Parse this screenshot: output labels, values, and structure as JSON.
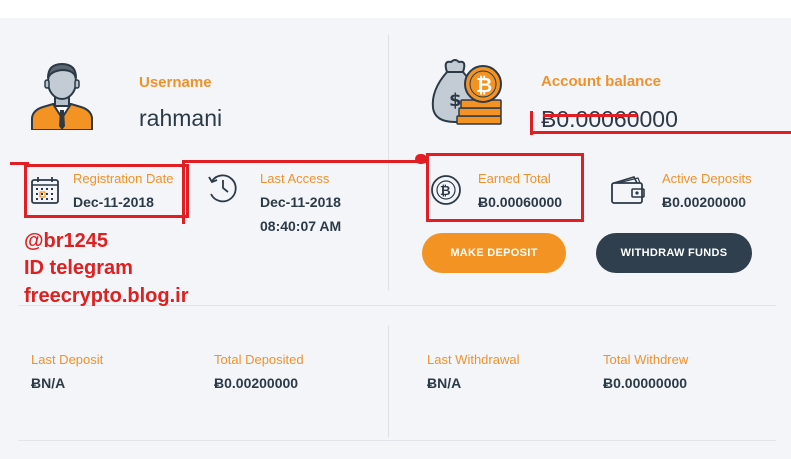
{
  "profile": {
    "username_label": "Username",
    "username": "rahmani",
    "registration_label": "Registration Date",
    "registration_date": "Dec-11-2018",
    "last_access_label": "Last Access",
    "last_access_date": "Dec-11-2018",
    "last_access_time": "08:40:07 AM"
  },
  "balance": {
    "label": "Account balance",
    "value": "Ƀ0.00060000",
    "earned_label": "Earned Total",
    "earned_value": "Ƀ0.00060000",
    "active_label": "Active Deposits",
    "active_value": "Ƀ0.00200000"
  },
  "buttons": {
    "deposit": "MAKE DEPOSIT",
    "withdraw": "WITHDRAW FUNDS"
  },
  "stats": {
    "last_deposit_label": "Last Deposit",
    "last_deposit": "ɃN/A",
    "total_deposited_label": "Total Deposited",
    "total_deposited": "Ƀ0.00200000",
    "last_withdrawal_label": "Last Withdrawal",
    "last_withdrawal": "ɃN/A",
    "total_withdrew_label": "Total Withdrew",
    "total_withdrew": "Ƀ0.00000000"
  },
  "watermark": {
    "line1": "@br1245",
    "line2": "ID telegram",
    "line3": "freecrypto.blog.ir"
  },
  "colors": {
    "accent": "#f0922a",
    "text": "#2c3a47",
    "annotation": "#e01e24"
  },
  "icons": [
    "user-avatar-icon",
    "calendar-icon",
    "clock-history-icon",
    "money-bag-icon",
    "bitcoin-coin-icon",
    "wallet-icon"
  ]
}
